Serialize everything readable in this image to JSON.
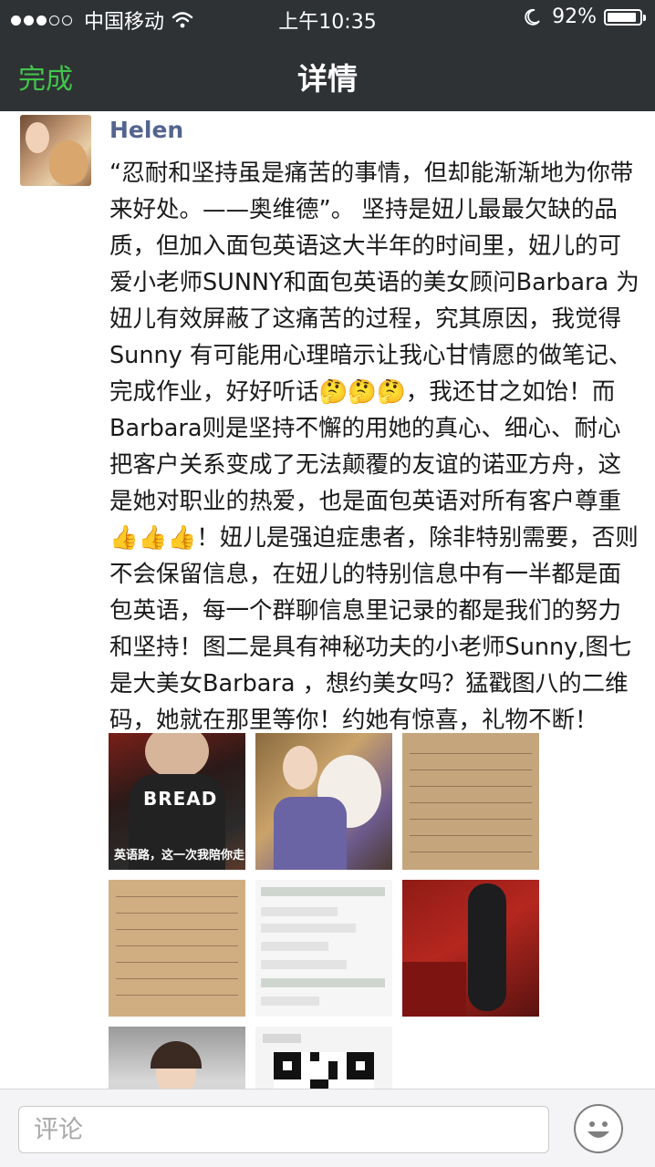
{
  "status_bar": {
    "signal_dots_filled": 3,
    "signal_dots_total": 5,
    "carrier": "中国移动",
    "wifi_icon": "wifi-icon",
    "time": "上午10:35",
    "moon_icon": "moon-icon",
    "battery_percent_label": "92%",
    "battery_level": 0.92
  },
  "nav": {
    "done_label": "完成",
    "title": "详情"
  },
  "post": {
    "username": "Helen",
    "text": "“忍耐和坚持虽是痛苦的事情，但却能渐渐地为你带来好处。——奥维德”。 坚持是妞儿最最欠缺的品质，但加入面包英语这大半年的时间里，妞儿的可爱小老师SUNNY和面包英语的美女顾问Barbara 为妞儿有效屏蔽了这痛苦的过程，究其原因，我觉得Sunny 有可能用心理暗示让我心甘情愿的做笔记、完成作业，好好听话🤔🤔🤔，我还甘之如饴！而Barbara则是坚持不懈的用她的真心、细心、耐心把客户关系变成了无法颠覆的友谊的诺亚方舟，这是她对职业的热爱，也是面包英语对所有客户尊重👍👍👍！妞儿是强迫症患者，除非特别需要，否则不会保留信息，在妞儿的特别信息中有一半都是面包英语，每一个群聊信息里记录的都是我们的努力和坚持！图二是具有神秘功夫的小老师Sunny,图七是大美女Barbara ，想约美女吗？猛戳图八的二维码，她就在那里等你！约她有惊喜，礼物不断！",
    "photos": [
      {
        "id": "photo-1",
        "caption": "英语路，这一次我陪你走",
        "shirt_text": "BREAD"
      },
      {
        "id": "photo-2"
      },
      {
        "id": "photo-3"
      },
      {
        "id": "photo-4"
      },
      {
        "id": "photo-5"
      },
      {
        "id": "photo-6"
      },
      {
        "id": "photo-7"
      },
      {
        "id": "photo-8"
      }
    ]
  },
  "comment_bar": {
    "placeholder": "评论",
    "emoji_icon": "smiley-icon"
  },
  "colors": {
    "bar_background": "#2f3235",
    "done_green": "#43c54c",
    "username_blue": "#54648f"
  }
}
